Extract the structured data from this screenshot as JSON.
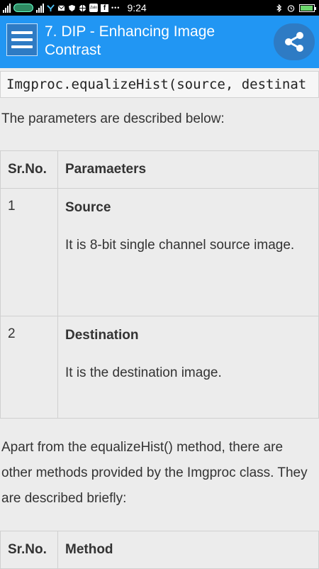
{
  "status_bar": {
    "time": "9:24",
    "icons": [
      "signal-icon",
      "carrier-pill-icon",
      "signal-icon",
      "share-network-icon",
      "mail-icon",
      "shield-icon",
      "globe-icon",
      "zalo-icon",
      "facebook-icon",
      "more-icon",
      "bluetooth-icon",
      "alarm-icon",
      "battery-icon"
    ],
    "zalo_label": "Zalo",
    "more": "•••"
  },
  "app_bar": {
    "title": "7. DIP - Enhancing Image Contrast",
    "menu_icon": "hamburger-icon",
    "share_icon": "share-icon",
    "color": "#2196f3"
  },
  "content": {
    "code": "Imgproc.equalizeHist(source, destinat",
    "intro": "The parameters are described below:",
    "table1": {
      "headers": [
        "Sr.No.",
        "Paramaeters"
      ],
      "rows": [
        {
          "num": "1",
          "name": "Source",
          "desc": "It is 8-bit single channel source image."
        },
        {
          "num": "2",
          "name": "Destination",
          "desc": "It is the destination image."
        }
      ]
    },
    "paragraph2": "Apart from the equalizeHist() method, there are other methods provided by the Imgproc class. They are described briefly:",
    "table2": {
      "headers": [
        "Sr.No.",
        "Method"
      ]
    }
  }
}
